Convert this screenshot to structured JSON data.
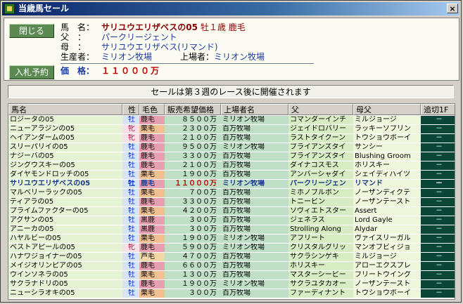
{
  "window": {
    "title": "当歳馬セール",
    "close_glyph": "×"
  },
  "buttons": {
    "close": "閉じる",
    "bid": "入札予約"
  },
  "detail": {
    "name_label": "馬　名：",
    "name": "サリユウエリザベスの05",
    "sex_age": "牡１歳 鹿毛",
    "sire_label": "父　：",
    "sire": "パークリージェント",
    "dam_label": "母　：",
    "dam": "サリユウエリザベス(リマンド)",
    "breeder_label": "生産者：",
    "breeder": "ミリオン牧場",
    "owner_label": "上場者：",
    "owner": "ミリオン牧場",
    "price_label": "価　格：",
    "price": "１１０００万"
  },
  "banner": "セールは第３週のレース後に開催されます",
  "table": {
    "headers": [
      "馬名",
      "性",
      "毛色",
      "販売希望価格",
      "上場者名",
      "父",
      "母父",
      "追切1F"
    ],
    "rows": [
      [
        "ロジータの05",
        "牡",
        "鹿毛",
        "８５００万",
        "ミリオン牧場",
        "コマンダーインチ",
        "ミルジョージ",
        "－"
      ],
      [
        "ニューアラジンの05",
        "牝",
        "栗毛",
        "２３００万",
        "百万牧場",
        "ジェイドロバリー",
        "ラッキーソブリン",
        "－"
      ],
      [
        "ヘイアンダームの05",
        "牝",
        "鹿毛",
        "２１００万",
        "百万牧場",
        "ラストタイクーン",
        "トウショウボーイ",
        "－"
      ],
      [
        "スリーパリイの05",
        "牡",
        "鹿毛",
        "９５００万",
        "ミリオン牧場",
        "ブライアンズタイ",
        "サンシー",
        "－"
      ],
      [
        "ナジーバの05",
        "牡",
        "鹿毛",
        "３３００万",
        "百万牧場",
        "ブライアンズタイ",
        "Blushing Groom",
        "－"
      ],
      [
        "ジングウスキーの05",
        "牡",
        "鹿毛",
        "２１００万",
        "百万牧場",
        "ダイナコスモス",
        "ホリスキー",
        "－"
      ],
      [
        "ダイヤモンドロッチの05",
        "牡",
        "栗毛",
        "１９００万",
        "百万牧場",
        "アンバーシャダイ",
        "シェイディハイツ",
        "－"
      ],
      [
        "サリユウエリザベスの05",
        "牡",
        "鹿毛",
        "１１０００万",
        "ミリオン牧場",
        "パークリージェン",
        "リマンド",
        "－"
      ],
      [
        "マルベリーラックの05",
        "牡",
        "栗毛",
        "７００万",
        "百万牧場",
        "ミホノブルボン",
        "ノーザンディクテ",
        "－"
      ],
      [
        "ティアラの05",
        "牡",
        "鹿毛",
        "３３００万",
        "百万牧場",
        "トニービン",
        "ノーザンテースト",
        "－"
      ],
      [
        "プライムファクターの05",
        "牡",
        "栗毛",
        "４２００万",
        "百万牧場",
        "ソヴィエトスター",
        "Assert",
        "－"
      ],
      [
        "アグサンの05",
        "牡",
        "黒鹿",
        "３００万",
        "百万牧場",
        "ジェネラス",
        "Lord Gayle",
        "－"
      ],
      [
        "アニーカの05",
        "牡",
        "黒鹿",
        "３００万",
        "百万牧場",
        "Strolling Along",
        "Alydar",
        "－"
      ],
      [
        "ハヤルビーの05",
        "牡",
        "栗毛",
        "１９００万",
        "ミリオン牧場",
        "アフリート",
        "ヴァイスリーガル",
        "－"
      ],
      [
        "ベストアピールの05",
        "牝",
        "鹿毛",
        "５９００万",
        "ミリオン牧場",
        "クリスタルグリッ",
        "マンオブビィジョ",
        "－"
      ],
      [
        "ハナワジョイナーの05",
        "牡",
        "芦毛",
        "４７００万",
        "百万牧場",
        "サクラシンゲキ",
        "ミルジョージ",
        "－"
      ],
      [
        "メイジオリンピアの05",
        "牡",
        "鹿毛",
        "６６００万",
        "百万牧場",
        "ホリスキー",
        "アローエクスプレ",
        "－"
      ],
      [
        "ウインソネラの05",
        "牡",
        "栗毛",
        "１３００万",
        "百万牧場",
        "マスターシービー",
        "フリートウイング",
        "－"
      ],
      [
        "サクラナドリの05",
        "牡",
        "鹿毛",
        "１９００万",
        "ミリオン牧場",
        "サクラユタカオー",
        "ノーザンテースト",
        "－"
      ],
      [
        "ニューシラオキの05",
        "牡",
        "栗毛",
        "３００万",
        "百万牧場",
        "ファーディナント",
        "トウショウボーイ",
        "－"
      ]
    ]
  }
}
